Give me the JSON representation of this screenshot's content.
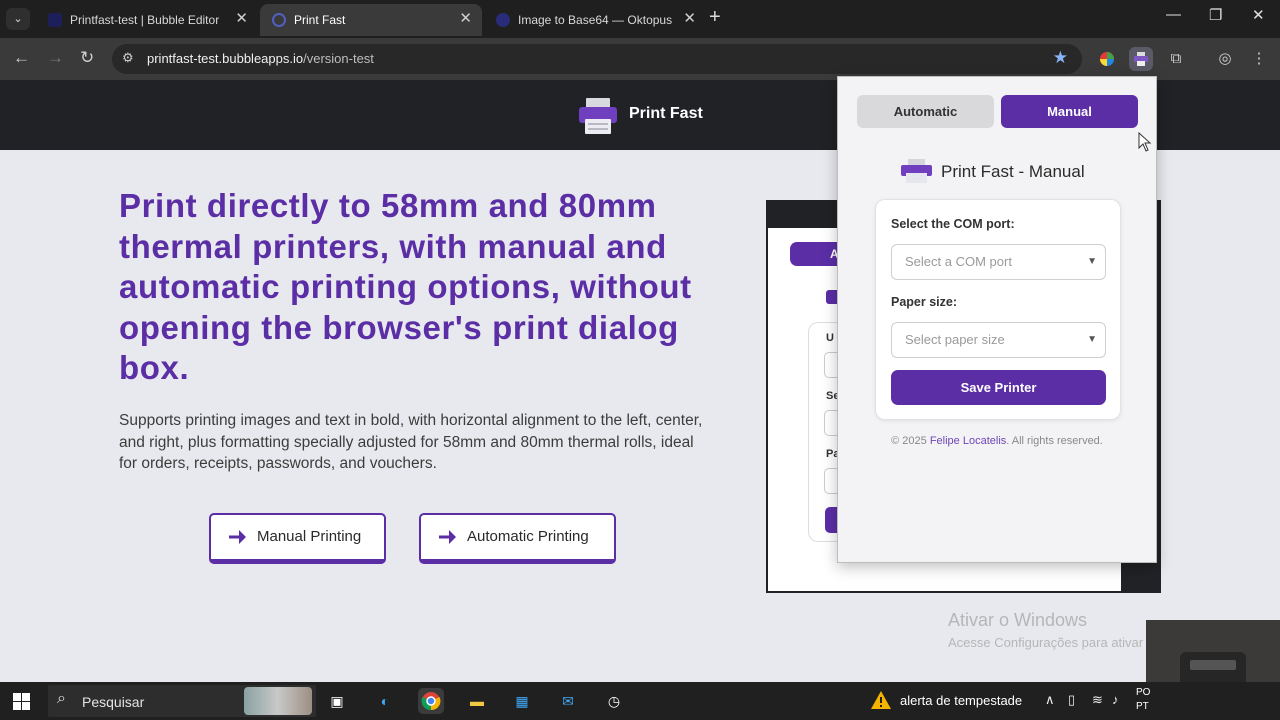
{
  "browser": {
    "tabs": [
      {
        "title": "Printfast-test | Bubble Editor",
        "active": false
      },
      {
        "title": "Print Fast",
        "active": true
      },
      {
        "title": "Image to Base64 — Oktopus To",
        "active": false
      }
    ],
    "url_host": "printfast-test.bubbleapps.io",
    "url_path": "/version-test"
  },
  "site": {
    "brand": "Print Fast",
    "hero_title": "Print directly to 58mm and 80mm thermal printers, with manual and automatic printing options, without opening the browser's print dialog box.",
    "hero_description": "Supports printing images and text in bold, with horizontal alignment to the left, center, and right, plus formatting specially adjusted for 58mm and 80mm thermal rolls, ideal for orders, receipts, passwords, and vouchers.",
    "buttons": {
      "manual": "Manual Printing",
      "automatic": "Automatic Printing"
    },
    "preview": {
      "pill": "A",
      "label1": "U",
      "label2": "Se",
      "label3": "Pa"
    }
  },
  "popup": {
    "tab_automatic": "Automatic",
    "tab_manual": "Manual",
    "title": "Print Fast - Manual",
    "com_label": "Select the COM port:",
    "com_placeholder": "Select a COM port",
    "paper_label": "Paper size:",
    "paper_placeholder": "Select paper size",
    "save_button": "Save Printer",
    "footer_prefix": "© 2025",
    "footer_author": "Felipe Locatelis",
    "footer_suffix": ". All rights reserved."
  },
  "os": {
    "watermark_title": "Ativar o Windows",
    "watermark_sub": "Acesse Configurações para ativar",
    "search_placeholder": "Pesquisar",
    "weather_alert": "alerta de tempestade",
    "clock_line1": "PO",
    "clock_line2": "PT"
  },
  "colors": {
    "accent": "#5b2ea6",
    "header": "#202225"
  }
}
